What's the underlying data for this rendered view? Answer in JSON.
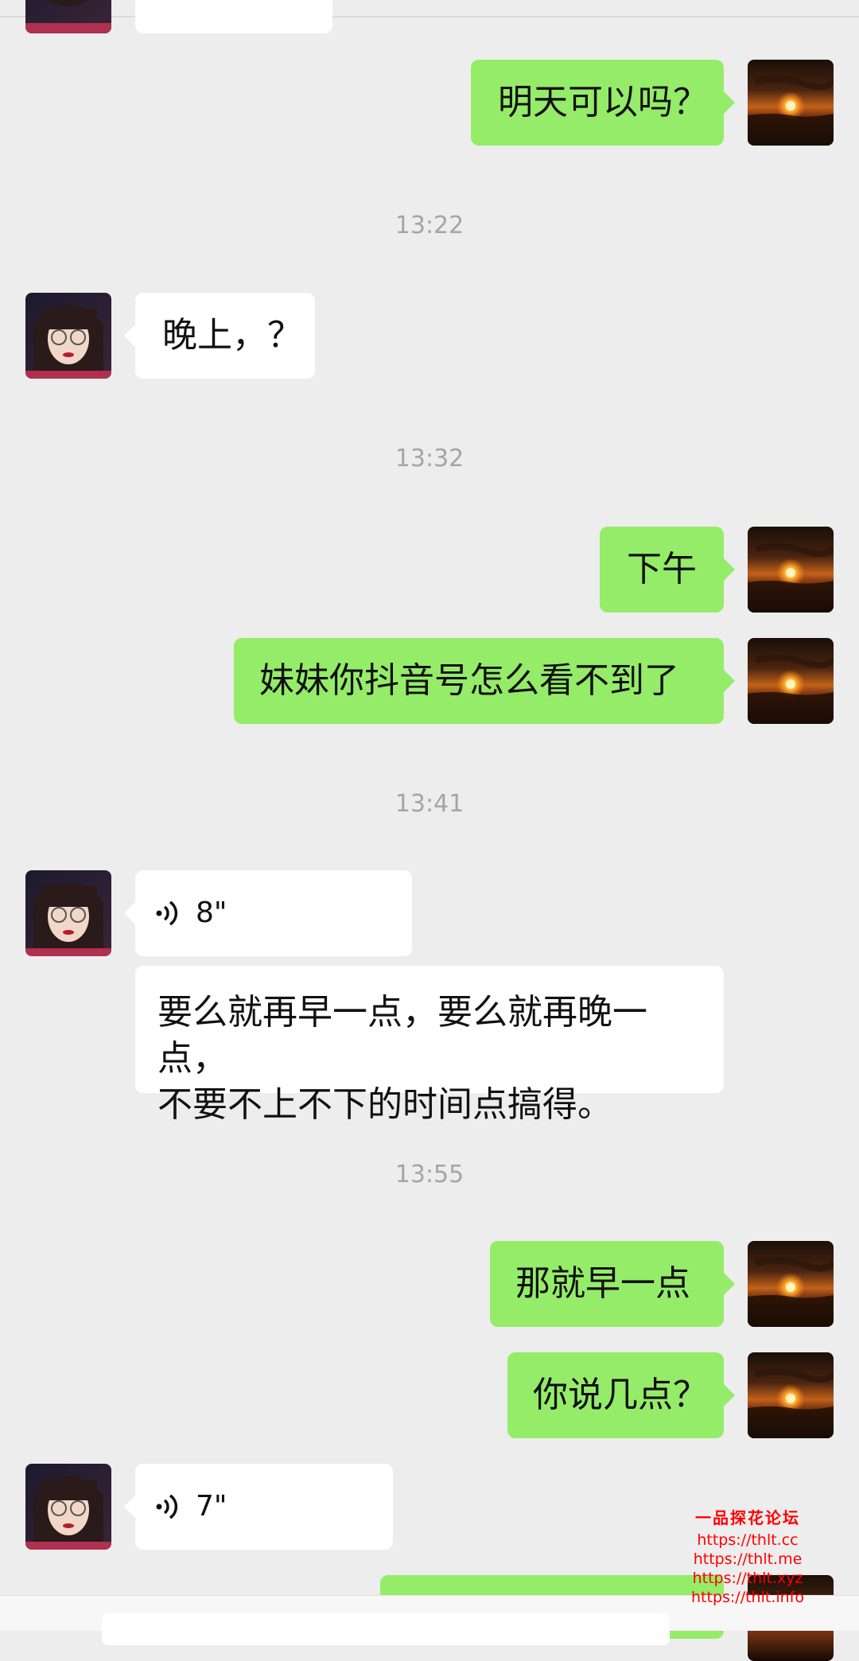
{
  "messages": [
    {
      "side": "right",
      "text": "明天可以吗？"
    },
    {
      "type": "time",
      "text": "13:22"
    },
    {
      "side": "left",
      "text": "晚上，？"
    },
    {
      "type": "time",
      "text": "13:32"
    },
    {
      "side": "right",
      "text": "下午"
    },
    {
      "side": "right",
      "text": "妹妹你抖音号怎么看不到了"
    },
    {
      "type": "time",
      "text": "13:41"
    },
    {
      "side": "left",
      "kind": "voice",
      "duration": "8\""
    },
    {
      "side": "left",
      "text": "要么就再早一点，要么就再晚一点，不要不上不下的时间点搞得。",
      "line1": "要么就再早一点，要么就再晚一点，",
      "line2": "不要不上不下的时间点搞得。"
    },
    {
      "type": "time",
      "text": "13:55"
    },
    {
      "side": "right",
      "text": "那就早一点"
    },
    {
      "side": "right",
      "text": "你说几点？"
    },
    {
      "side": "left",
      "kind": "voice",
      "duration": "7\""
    }
  ],
  "watermark": {
    "title": "一品探花论坛",
    "links": [
      "https://thlt.cc",
      "https://thlt.me",
      "https://thlt.xyz",
      "https://thlt.info"
    ]
  },
  "colors": {
    "background": "#ededed",
    "self_bubble": "#95ec69",
    "other_bubble": "#ffffff",
    "timestamp": "#a5a5a5"
  },
  "icons": {
    "voice": "voice-wave-icon",
    "self_avatar": "sunset-avatar",
    "contact_avatar": "girl-avatar"
  }
}
